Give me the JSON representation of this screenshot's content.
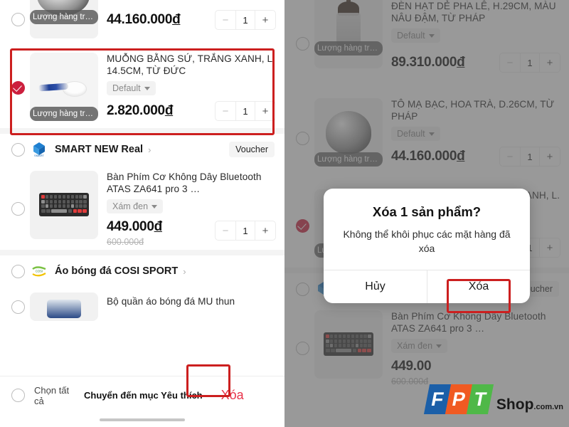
{
  "app": {
    "watermark": {
      "letters": [
        "F",
        "P",
        "T"
      ],
      "shop": "Shop",
      "tld": ".com.vn"
    }
  },
  "icons": {
    "chevron_right": "›",
    "minus": "−",
    "plus": "+"
  },
  "left_panel": {
    "top_partial_item": {
      "stock_label": "Lượng hàng tro...",
      "price": "44.160.000",
      "currency": "đ",
      "qty": "1",
      "selected": false
    },
    "highlighted_item": {
      "selected": true,
      "title": "MUỖNG BẰNG SỨ, TRẮNG XANH,  L. 14.5CM, TỪ ĐỨC",
      "variant": "Default",
      "stock_label": "Lượng hàng tro...",
      "price": "2.820.000",
      "currency": "đ",
      "qty": "1"
    },
    "shop_smart": {
      "name": "SMART NEW Real",
      "voucher": "Voucher",
      "selected": false,
      "item": {
        "selected": false,
        "title": "Bàn Phím Cơ Không Dây Bluetooth ATAS ZA641 pro 3 …",
        "variant": "Xám đen",
        "price": "449.000",
        "currency": "đ",
        "price_old": "600.000đ",
        "qty": "1"
      }
    },
    "shop_cosi": {
      "name": "Áo bóng đá COSI SPORT",
      "selected": false,
      "item": {
        "title": "Bộ quần áo bóng đá MU thun"
      }
    },
    "bottom_bar": {
      "select_all": "Chọn tất cả",
      "wishlist": "Chuyển đến mục Yêu thích",
      "delete": "Xóa"
    }
  },
  "right_panel": {
    "item_lamp": {
      "selected": false,
      "title": "ĐÈN HẠT DẺ PHA LÊ, H.29CM, MÀU NÂU ĐẬM, TỪ PHÁP",
      "variant": "Default",
      "stock_label": "Lượng hàng tro...",
      "price": "89.310.000",
      "currency": "đ",
      "qty": "1"
    },
    "item_bowl": {
      "selected": false,
      "title": "TÔ MẠ BẠC, HOA TRÀ, D.26CM, TỪ PHÁP",
      "variant": "Default",
      "stock_label": "Lượng hàng tro...",
      "price": "44.160.000",
      "currency": "đ",
      "qty": "1"
    },
    "item_spoon": {
      "selected": true
    },
    "shop_smart": {
      "name": "SMART NEW Real",
      "voucher": "Voucher"
    },
    "item_keyboard": {
      "selected": false,
      "title": "Bàn Phím Cơ Không Dây Bluetooth ATAS ZA641 pro 3 …",
      "variant": "Xám đen",
      "price": "449.00",
      "price_old": "600.000đ",
      "qty": "1"
    },
    "dialog": {
      "title": "Xóa 1 sản phẩm?",
      "message": "Không thể khôi phục các mặt hàng đã xóa",
      "cancel": "Hủy",
      "confirm": "Xóa"
    }
  },
  "colors": {
    "accent_red": "#cc1f1f",
    "check_red": "#cc1f3d",
    "delete_text": "#e8334a"
  }
}
